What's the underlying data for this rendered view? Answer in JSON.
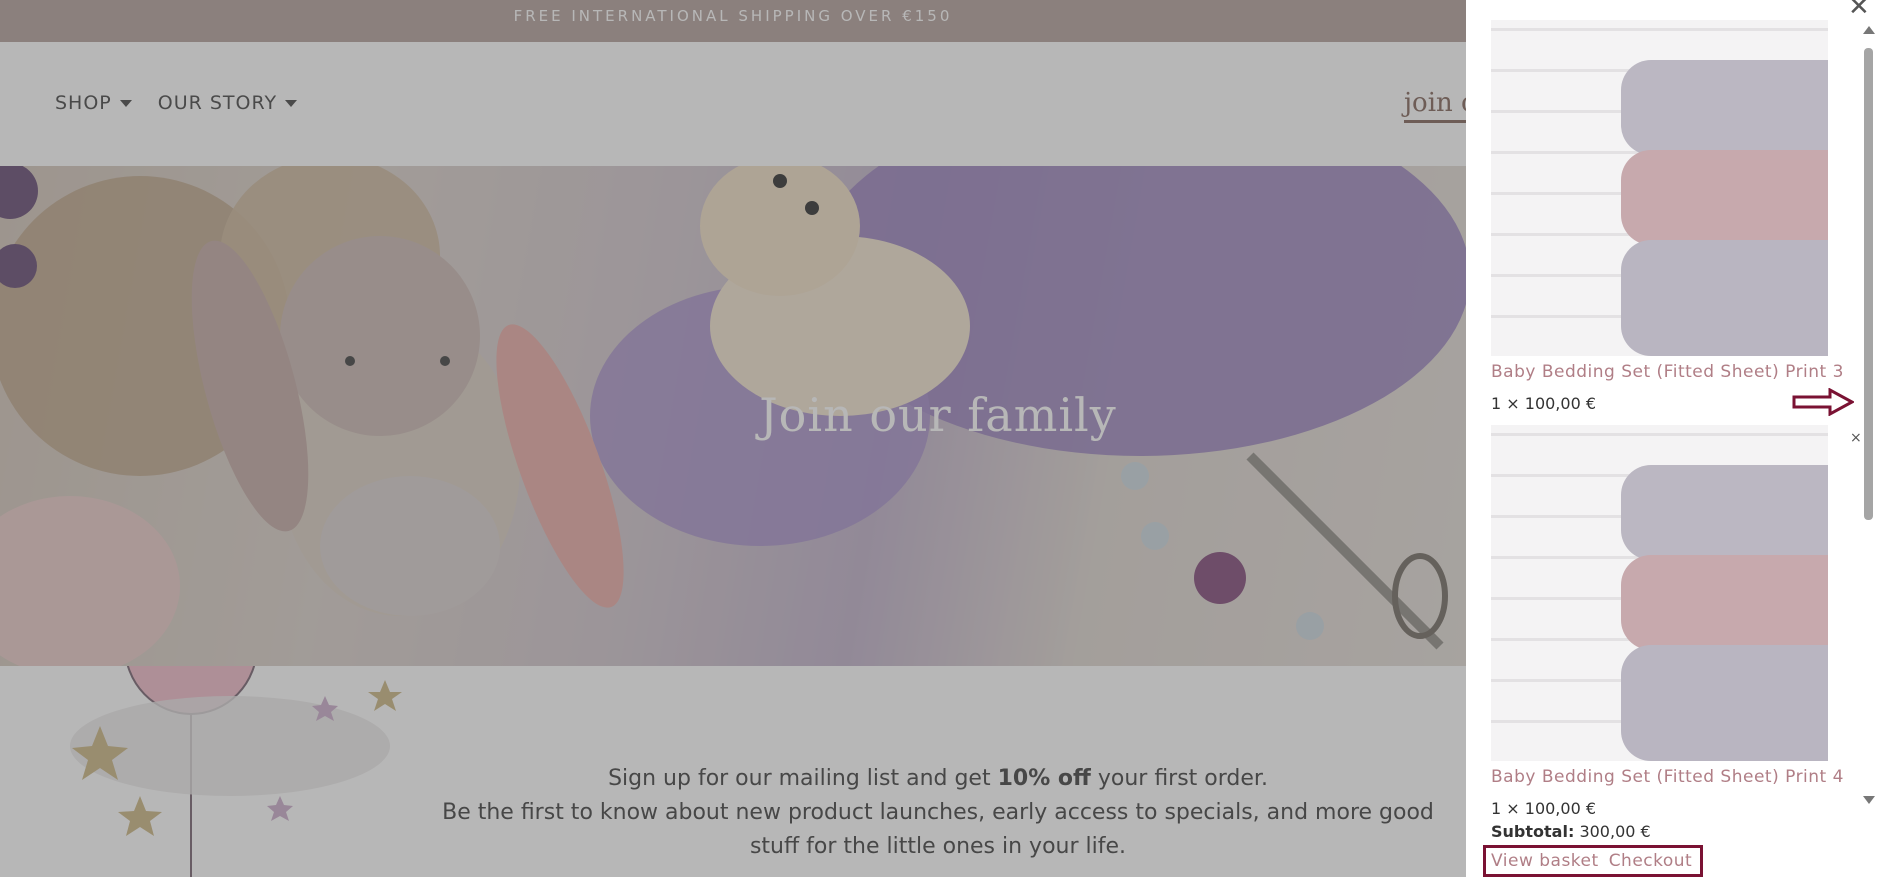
{
  "announcement": "FREE INTERNATIONAL SHIPPING OVER €150",
  "nav": [
    {
      "label": "SHOP"
    },
    {
      "label": "OUR STORY"
    }
  ],
  "header_link": "join o",
  "hero": {
    "title": "Join our family"
  },
  "signup": {
    "line1_prefix": "Sign up for our mailing list and get ",
    "line1_bold": "10% off",
    "line1_suffix": " your first order.",
    "line2": "Be the first to know about new product launches, early access to specials, and more good",
    "line3": "stuff for the little ones in your life."
  },
  "cart": {
    "items": [
      {
        "name": "Baby Bedding Set (Fitted Sheet) Print 3",
        "qty": "1 × 100,00 €"
      },
      {
        "name": "Baby Bedding Set (Fitted Sheet) Print 4",
        "qty": "1 × 100,00 €"
      }
    ],
    "subtotal_label": "Subtotal:",
    "subtotal_value": "300,00 €",
    "view_basket": "View basket",
    "checkout": "Checkout",
    "close": "✕",
    "remove": "×"
  },
  "colors": {
    "announcement_bg": "#b09b95",
    "accent": "#b07e86",
    "highlight_border": "#7a1233"
  }
}
